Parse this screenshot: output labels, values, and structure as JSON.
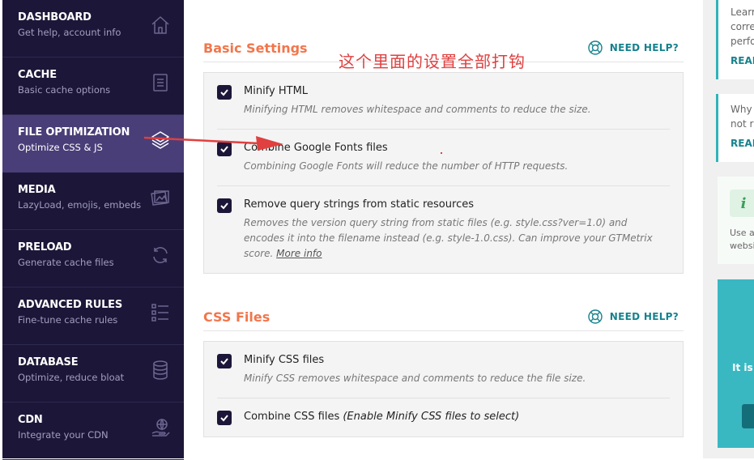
{
  "sidebar": {
    "items": [
      {
        "title": "DASHBOARD",
        "sub": "Get help, account info",
        "icon": "home-icon"
      },
      {
        "title": "CACHE",
        "sub": "Basic cache options",
        "icon": "file-icon"
      },
      {
        "title": "FILE OPTIMIZATION",
        "sub": "Optimize CSS & JS",
        "icon": "layers-icon",
        "active": true
      },
      {
        "title": "MEDIA",
        "sub": "LazyLoad, emojis, embeds",
        "icon": "images-icon"
      },
      {
        "title": "PRELOAD",
        "sub": "Generate cache files",
        "icon": "refresh-icon"
      },
      {
        "title": "ADVANCED RULES",
        "sub": "Fine-tune cache rules",
        "icon": "list-icon"
      },
      {
        "title": "DATABASE",
        "sub": "Optimize, reduce bloat",
        "icon": "database-icon"
      },
      {
        "title": "CDN",
        "sub": "Integrate your CDN",
        "icon": "globe-hand-icon"
      }
    ]
  },
  "annotation": {
    "text": "这个里面的设置全部打钩",
    "color": "#e04040"
  },
  "sections": [
    {
      "title": "Basic Settings",
      "help": "NEED HELP?",
      "fields": [
        {
          "label": "Minify HTML",
          "desc": "Minifying HTML removes whitespace and comments to reduce the size.",
          "checked": true
        },
        {
          "label": "Combine Google Fonts files",
          "desc": "Combining Google Fonts will reduce the number of HTTP requests.",
          "checked": true
        },
        {
          "label": "Remove query strings from static resources",
          "desc": "Removes the version query string from static files (e.g. style.css?ver=1.0) and encodes it into the filename instead (e.g. style-1.0.css). Can improve your GTMetrix score.",
          "link": "More info",
          "checked": true
        }
      ]
    },
    {
      "title": "CSS Files",
      "help": "NEED HELP?",
      "fields": [
        {
          "label": "Minify CSS files",
          "desc": "Minify CSS removes whitespace and comments to reduce the file size.",
          "checked": true
        },
        {
          "label": "Combine CSS files",
          "label_em": "(Enable Minify CSS files to select)",
          "desc": "",
          "checked": true
        }
      ]
    }
  ],
  "right": {
    "box1": {
      "text1": "Learr",
      "text2": "corre",
      "text3": "perfo",
      "read": "READ"
    },
    "box2": {
      "text1": "Why",
      "text2": "not r",
      "read": "READ"
    },
    "tip": {
      "icon": "i",
      "text1": "Use a",
      "text2": "websi"
    },
    "teal": {
      "text": "It is a"
    }
  },
  "colors": {
    "sidebar_bg": "#1c1738",
    "sidebar_active": "#4a3e78",
    "section_title": "#f2764b",
    "help_teal": "#16828d",
    "accent_teal": "#39b8c2"
  }
}
